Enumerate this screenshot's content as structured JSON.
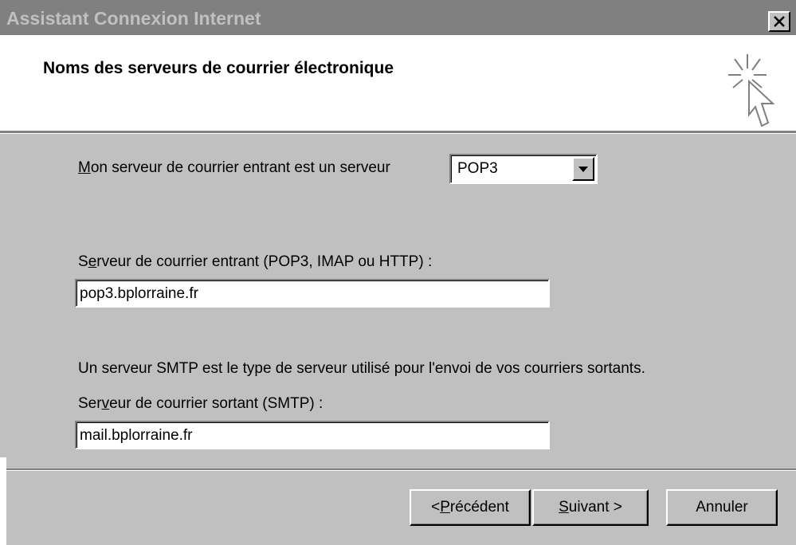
{
  "window": {
    "title": "Assistant Connexion Internet",
    "close_label": "✕"
  },
  "header": {
    "title": "Noms des serveurs de courrier électronique",
    "icon": "wizard-cursor-icon"
  },
  "incoming_type": {
    "label_access_key": "M",
    "label_rest": "on serveur de courrier entrant est un serveur",
    "selected": "POP3"
  },
  "incoming_server": {
    "label_pre": "S",
    "label_access_key": "e",
    "label_rest": "rveur de courrier entrant (POP3, IMAP ou HTTP) :",
    "value": "pop3.bplorraine.fr"
  },
  "smtp_info": "Un serveur SMTP est le type de serveur utilisé pour l'envoi de vos courriers sortants.",
  "outgoing_server": {
    "label_pre": "Ser",
    "label_access_key": "v",
    "label_rest": "eur de courrier sortant (SMTP) :",
    "value": "mail.bplorraine.fr"
  },
  "buttons": {
    "back_pre": "< ",
    "back_access_key": "P",
    "back_rest": "récédent",
    "next_access_key": "S",
    "next_rest": "uivant >",
    "cancel": "Annuler"
  },
  "colors": {
    "dialog_gray": "#c0c0c0",
    "titlebar_gray": "#808080"
  }
}
